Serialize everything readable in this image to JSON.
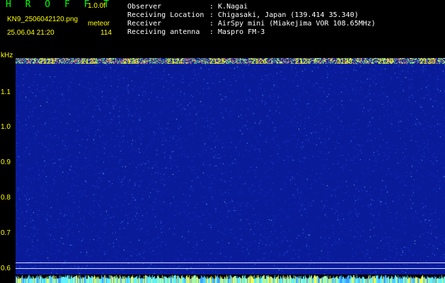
{
  "header": {
    "brand": "H R O F F T",
    "version": "1.0.0f",
    "filename": "KN9_2506042120.png",
    "datetime": "25.06.04 21:20",
    "meteor_label": "meteor",
    "meteor_count": "114",
    "fields": [
      {
        "label": "Observer",
        "value": ": K.Nagai"
      },
      {
        "label": "Receiving Location",
        "value": ": Chigasaki, Japan (139.414 35.340)"
      },
      {
        "label": "Receiver",
        "value": ": AirSpy mini (Miakejima VOR 108.65MHz)"
      },
      {
        "label": "Receiving antenna",
        "value": ": Maspro FM-3"
      }
    ]
  },
  "axis": {
    "y_unit": "kHz",
    "y_ticks": [
      "1.1",
      "1.0",
      "0.9",
      "0.8",
      "0.7",
      "0.6"
    ],
    "x_ticks": [
      "2121",
      "2122",
      "2123",
      "2124",
      "2125",
      "2126",
      "2127",
      "2128",
      "2129",
      "2130"
    ]
  },
  "colors": {
    "background": "#000000",
    "spectrogram": "#0a1b9a",
    "label": "#ffff00",
    "brand": "#00ff00"
  }
}
